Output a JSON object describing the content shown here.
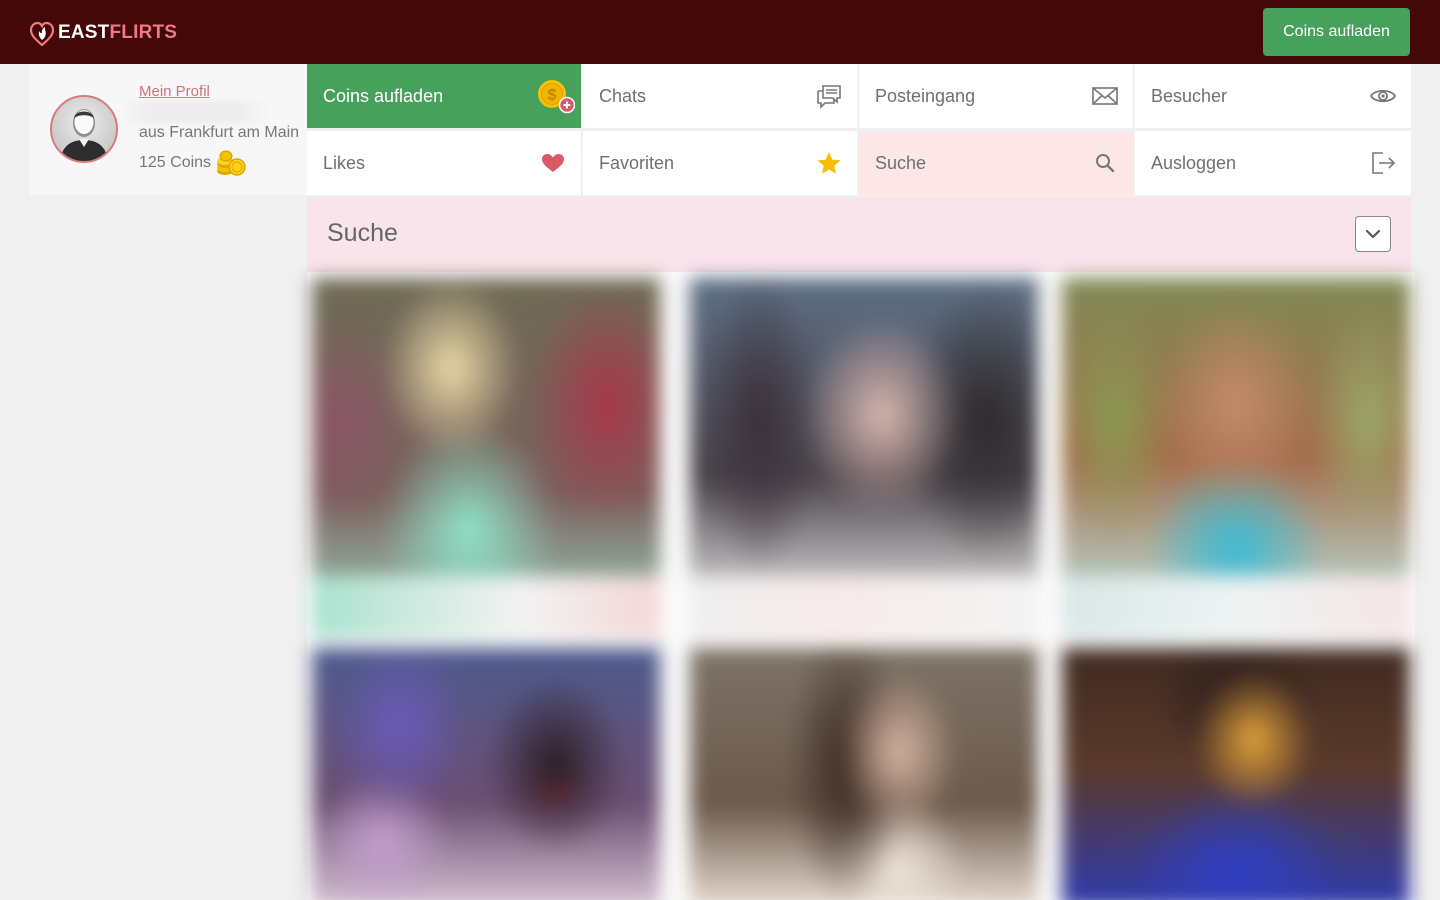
{
  "header": {
    "brand_primary": "EAST",
    "brand_secondary": "FLIRTS",
    "logo_icon": "heart-flame-icon",
    "cta_label": "Coins aufladen",
    "colors": {
      "bar": "#440809",
      "accent": "#f07a84",
      "cta": "#47a05b"
    }
  },
  "profile": {
    "link_label": "Mein Profil",
    "location": "aus Frankfurt am Main",
    "coins": "125 Coins",
    "avatar_icon": "default-avatar-icon",
    "coins_icon": "coin-stack-icon"
  },
  "nav": {
    "items": [
      {
        "label": "Coins aufladen",
        "icon": "coin-plus-icon",
        "state": "highlighted"
      },
      {
        "label": "Chats",
        "icon": "chat-bubbles-icon"
      },
      {
        "label": "Posteingang",
        "icon": "envelope-icon"
      },
      {
        "label": "Besucher",
        "icon": "eye-icon"
      },
      {
        "label": "Likes",
        "icon": "heart-icon"
      },
      {
        "label": "Favoriten",
        "icon": "star-icon"
      },
      {
        "label": "Suche",
        "icon": "search-icon",
        "state": "selected"
      },
      {
        "label": "Ausloggen",
        "icon": "logout-icon"
      }
    ]
  },
  "search": {
    "title": "Suche",
    "toggle_icon": "chevron-down-icon"
  },
  "results": {
    "blurred": true,
    "count_visible": 6
  }
}
